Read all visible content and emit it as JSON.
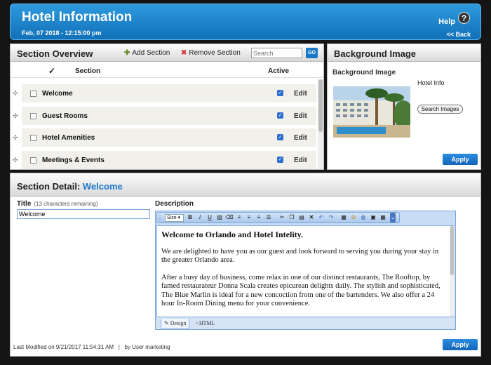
{
  "header": {
    "title": "Hotel Information",
    "datetime": "Feb, 07 2018 - 12:15:00 pm",
    "help_label": "Help",
    "help_icon_glyph": "?",
    "back_label": "<< Back"
  },
  "overview": {
    "title": "Section Overview",
    "add_label": "Add Section",
    "remove_label": "Remove Section",
    "search_placeholder": "Search",
    "go_label": "GO",
    "columns": {
      "check": "✓",
      "section": "Section",
      "active": "Active"
    },
    "rows": [
      {
        "name": "Welcome",
        "active": true,
        "edit": "Edit"
      },
      {
        "name": "Guest Rooms",
        "active": true,
        "edit": "Edit"
      },
      {
        "name": "Hotel Amenities",
        "active": true,
        "edit": "Edit"
      },
      {
        "name": "Meetings & Events",
        "active": true,
        "edit": "Edit"
      }
    ]
  },
  "background": {
    "panel_title": "Background Image",
    "label": "Background Image",
    "image_name": "Hotel Info",
    "search_button": "Search Images",
    "apply": "Apply"
  },
  "detail": {
    "heading_prefix": "Section Detail:",
    "heading_section": "Welcome",
    "title_label": "Title",
    "title_note": "(13 characters remaining)",
    "title_value": "Welcome",
    "description_label": "Description",
    "size_label": "Size",
    "content": {
      "heading": "Welcome to Orlando and Hotel Intelity.",
      "p1": "We are delighted to have you as our guest and look forward to serving you during your stay in the greater Orlando area.",
      "p2": "After a busy day of business, come relax in one of our distinct restaurants, The Rooftop, by famed restaurateur Donna Scala creates epicurean delights daily. The stylish and sophisticated, The Blue Marlin is ideal for a new concoction from one of the bartenders. We also offer a 24 hour In-Room Dining menu for your convenience."
    },
    "tab_design": "Design",
    "tab_html": "HTML",
    "last_modified": "Last Modified on 9/21/2017 11:54:31 AM",
    "separator": "|",
    "modified_by": "by User marketing",
    "apply": "Apply"
  },
  "colors": {
    "accent": "#1a78c8",
    "header_bg": "#1a80c8",
    "row_bg": "#f1f0ea"
  }
}
